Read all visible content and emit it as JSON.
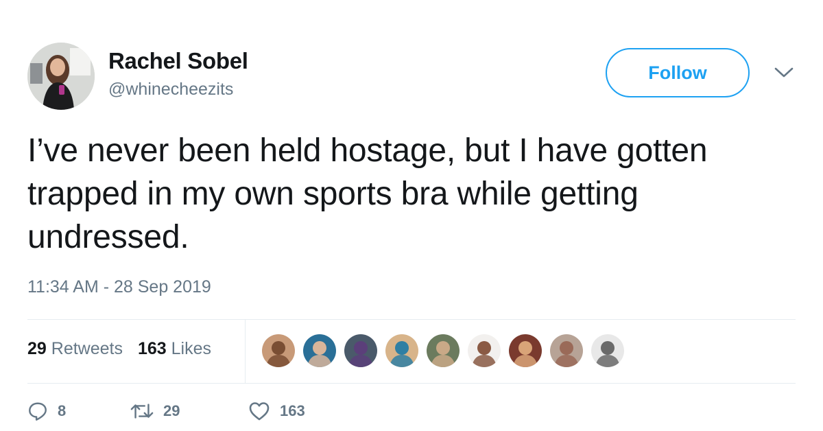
{
  "author": {
    "display_name": "Rachel Sobel",
    "handle": "@whinecheezits"
  },
  "follow_button": {
    "label": "Follow"
  },
  "tweet": {
    "text": "I’ve never been held hostage, but I have gotten trapped in my own sports bra while getting undressed.",
    "timestamp": "11:34 AM - 28 Sep 2019"
  },
  "stats": {
    "retweets_count": "29",
    "retweets_label": "Retweets",
    "likes_count": "163",
    "likes_label": "Likes"
  },
  "likers": [
    {
      "name": "liker-1-avatar",
      "bg": "#c89a78",
      "fg": "#7a4e33"
    },
    {
      "name": "liker-2-avatar",
      "bg": "#2a6f97",
      "fg": "#d9b59a"
    },
    {
      "name": "liker-3-avatar",
      "bg": "#4a5a6a",
      "fg": "#5b3f7a"
    },
    {
      "name": "liker-4-avatar",
      "bg": "#d8b48a",
      "fg": "#2f7fa3"
    },
    {
      "name": "liker-5-avatar",
      "bg": "#6b7b5e",
      "fg": "#c9a987"
    },
    {
      "name": "liker-6-avatar",
      "bg": "#f2f0ee",
      "fg": "#8a5a44"
    },
    {
      "name": "liker-7-avatar",
      "bg": "#7a3a2e",
      "fg": "#d9a478"
    },
    {
      "name": "liker-8-avatar",
      "bg": "#b7a396",
      "fg": "#9a6a58"
    },
    {
      "name": "liker-9-avatar",
      "bg": "#e8e8e8",
      "fg": "#6a6a6a"
    }
  ],
  "actions": {
    "replies_count": "8",
    "retweets_count": "29",
    "likes_count": "163"
  },
  "colors": {
    "accent": "#1da1f2",
    "secondary_text": "#657786",
    "primary_text": "#14171a",
    "divider": "#e6ecf0"
  },
  "icons": {
    "reply": "reply-icon",
    "retweet": "retweet-icon",
    "like": "heart-icon",
    "menu": "chevron-down-icon"
  }
}
